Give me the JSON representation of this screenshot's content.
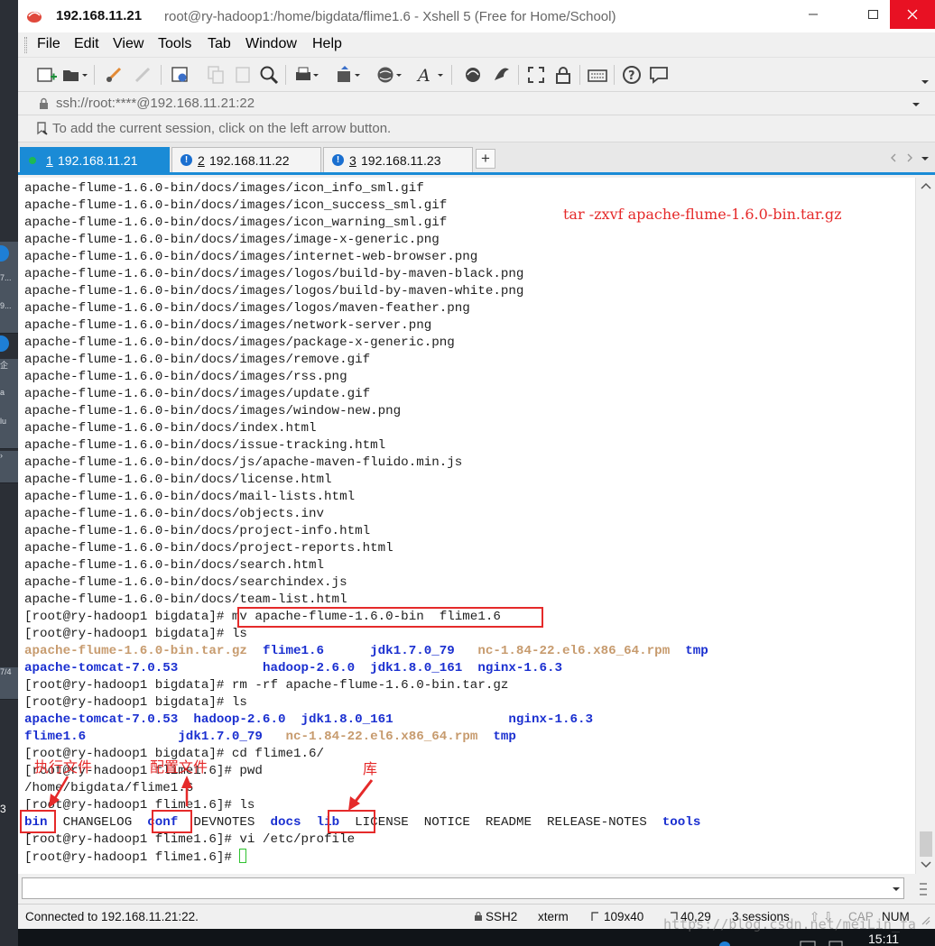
{
  "window": {
    "title_ip": "192.168.11.21",
    "title_path": "root@ry-hadoop1:/home/bigdata/flime1.6 - Xshell 5 (Free for Home/School)"
  },
  "menu": [
    "File",
    "Edit",
    "View",
    "Tools",
    "Tab",
    "Window",
    "Help"
  ],
  "address": {
    "text": "ssh://root:****@192.168.11.21:22"
  },
  "hint": {
    "text": "To add the current session, click on the left arrow button."
  },
  "tabs": [
    {
      "num": "1",
      "label": "192.168.11.21",
      "state": "connected"
    },
    {
      "num": "2",
      "label": "192.168.11.22",
      "state": "warning"
    },
    {
      "num": "3",
      "label": "192.168.11.23",
      "state": "warning"
    }
  ],
  "add_tab_label": "+",
  "terminal": {
    "file_lines": [
      "apache-flume-1.6.0-bin/docs/images/icon_info_sml.gif",
      "apache-flume-1.6.0-bin/docs/images/icon_success_sml.gif",
      "apache-flume-1.6.0-bin/docs/images/icon_warning_sml.gif",
      "apache-flume-1.6.0-bin/docs/images/image-x-generic.png",
      "apache-flume-1.6.0-bin/docs/images/internet-web-browser.png",
      "apache-flume-1.6.0-bin/docs/images/logos/build-by-maven-black.png",
      "apache-flume-1.6.0-bin/docs/images/logos/build-by-maven-white.png",
      "apache-flume-1.6.0-bin/docs/images/logos/maven-feather.png",
      "apache-flume-1.6.0-bin/docs/images/network-server.png",
      "apache-flume-1.6.0-bin/docs/images/package-x-generic.png",
      "apache-flume-1.6.0-bin/docs/images/remove.gif",
      "apache-flume-1.6.0-bin/docs/images/rss.png",
      "apache-flume-1.6.0-bin/docs/images/update.gif",
      "apache-flume-1.6.0-bin/docs/images/window-new.png",
      "apache-flume-1.6.0-bin/docs/index.html",
      "apache-flume-1.6.0-bin/docs/issue-tracking.html",
      "apache-flume-1.6.0-bin/docs/js/apache-maven-fluido.min.js",
      "apache-flume-1.6.0-bin/docs/license.html",
      "apache-flume-1.6.0-bin/docs/mail-lists.html",
      "apache-flume-1.6.0-bin/docs/objects.inv",
      "apache-flume-1.6.0-bin/docs/project-info.html",
      "apache-flume-1.6.0-bin/docs/project-reports.html",
      "apache-flume-1.6.0-bin/docs/search.html",
      "apache-flume-1.6.0-bin/docs/searchindex.js",
      "apache-flume-1.6.0-bin/docs/team-list.html"
    ],
    "prompt_bigdata": "[root@ry-hadoop1 bigdata]# ",
    "prompt_flime": "[root@ry-hadoop1 flime1.6]# ",
    "cmd_mv": "mv apache-flume-1.6.0-bin  flime1.6",
    "cmd_ls": "ls",
    "cmd_rm": "rm -rf apache-flume-1.6.0-bin.tar.gz",
    "cmd_cd": "cd flime1.6/",
    "cmd_pwd": "pwd",
    "pwd_output": "/home/bigdata/flime1.6",
    "cmd_vi": "vi /etc/profile",
    "ls1": {
      "tarball": "apache-flume-1.6.0-bin.tar.gz",
      "flime": "flime1.6",
      "jdk17": "jdk1.7.0_79",
      "rpm": "nc-1.84-22.el6.x86_64.rpm",
      "tmp": "tmp",
      "tomcat": "apache-tomcat-7.0.53",
      "hadoop": "hadoop-2.6.0",
      "jdk18": "jdk1.8.0_161",
      "nginx": "nginx-1.6.3"
    },
    "ls3": {
      "bin": "bin",
      "changelog": "CHANGELOG",
      "conf": "conf",
      "devnotes": "DEVNOTES",
      "docs": "docs",
      "lib": "lib",
      "license": "LICENSE",
      "notice": "NOTICE",
      "readme": "README",
      "release_notes": "RELEASE-NOTES",
      "tools": "tools"
    }
  },
  "annotations": {
    "tar_command": "tar -zxvf apache-flume-1.6.0-bin.tar.gz",
    "exec_files": "执行文件",
    "config_files": "配置文件",
    "library": "库",
    "color": "#e52a2a"
  },
  "status": {
    "connected": "Connected to 192.168.11.21:22.",
    "protocol": "SSH2",
    "term": "xterm",
    "size": "109x40",
    "pos": "40,29",
    "sessions": "3 sessions",
    "cap": "CAP",
    "num": "NUM"
  },
  "watermark": "https://blog.csdn.net/meiLin_fa",
  "clock": "15:11",
  "desktop_labels": [
    "7...",
    "9...",
    "企",
    "a",
    "lu",
    "7/4",
    "3"
  ],
  "colors": {
    "accent_tab": "#1a8bd6",
    "directory": "#1a2fd0",
    "archive": "#c79b6e",
    "close_button": "#e81123"
  }
}
